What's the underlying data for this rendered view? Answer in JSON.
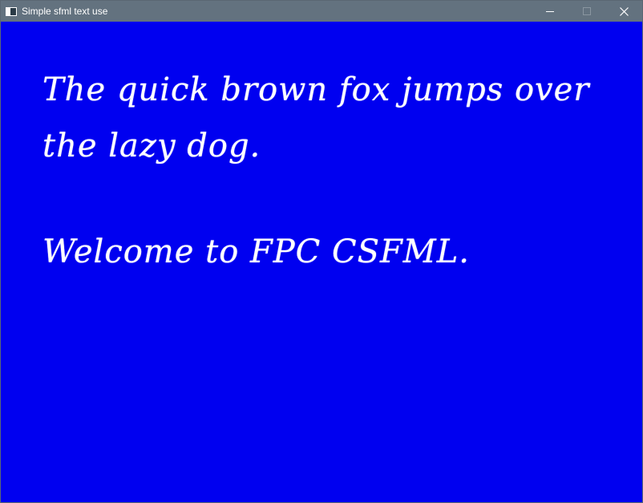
{
  "window": {
    "title": "Simple sfml text use",
    "icon": "app-window-icon",
    "controls": {
      "minimize_icon": "minimize-icon",
      "maximize_icon": "maximize-icon",
      "close_icon": "close-icon"
    },
    "titlebar_color": "#63727f"
  },
  "canvas": {
    "background_color": "#0000f0",
    "text_color": "#ffffff",
    "lines": [
      "The quick brown fox jumps over",
      "the lazy dog.",
      "Welcome to FPC CSFML."
    ]
  }
}
